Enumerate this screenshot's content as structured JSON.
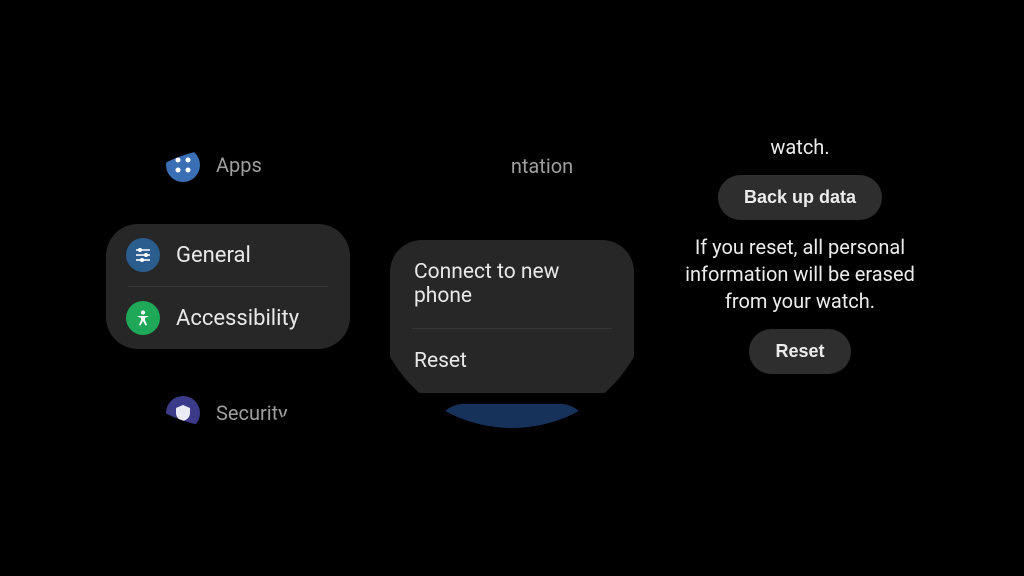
{
  "watch1": {
    "apps_label": "Apps",
    "general_label": "General",
    "accessibility_label": "Accessibility",
    "security_label": "Security"
  },
  "watch2": {
    "top_partial": "ntation",
    "connect_label": "Connect to new phone",
    "reset_label": "Reset"
  },
  "right": {
    "top_fragment": "watch.",
    "backup_btn": "Back up data",
    "warning": "If you reset, all personal information will be erased from your watch.",
    "reset_btn": "Reset"
  }
}
